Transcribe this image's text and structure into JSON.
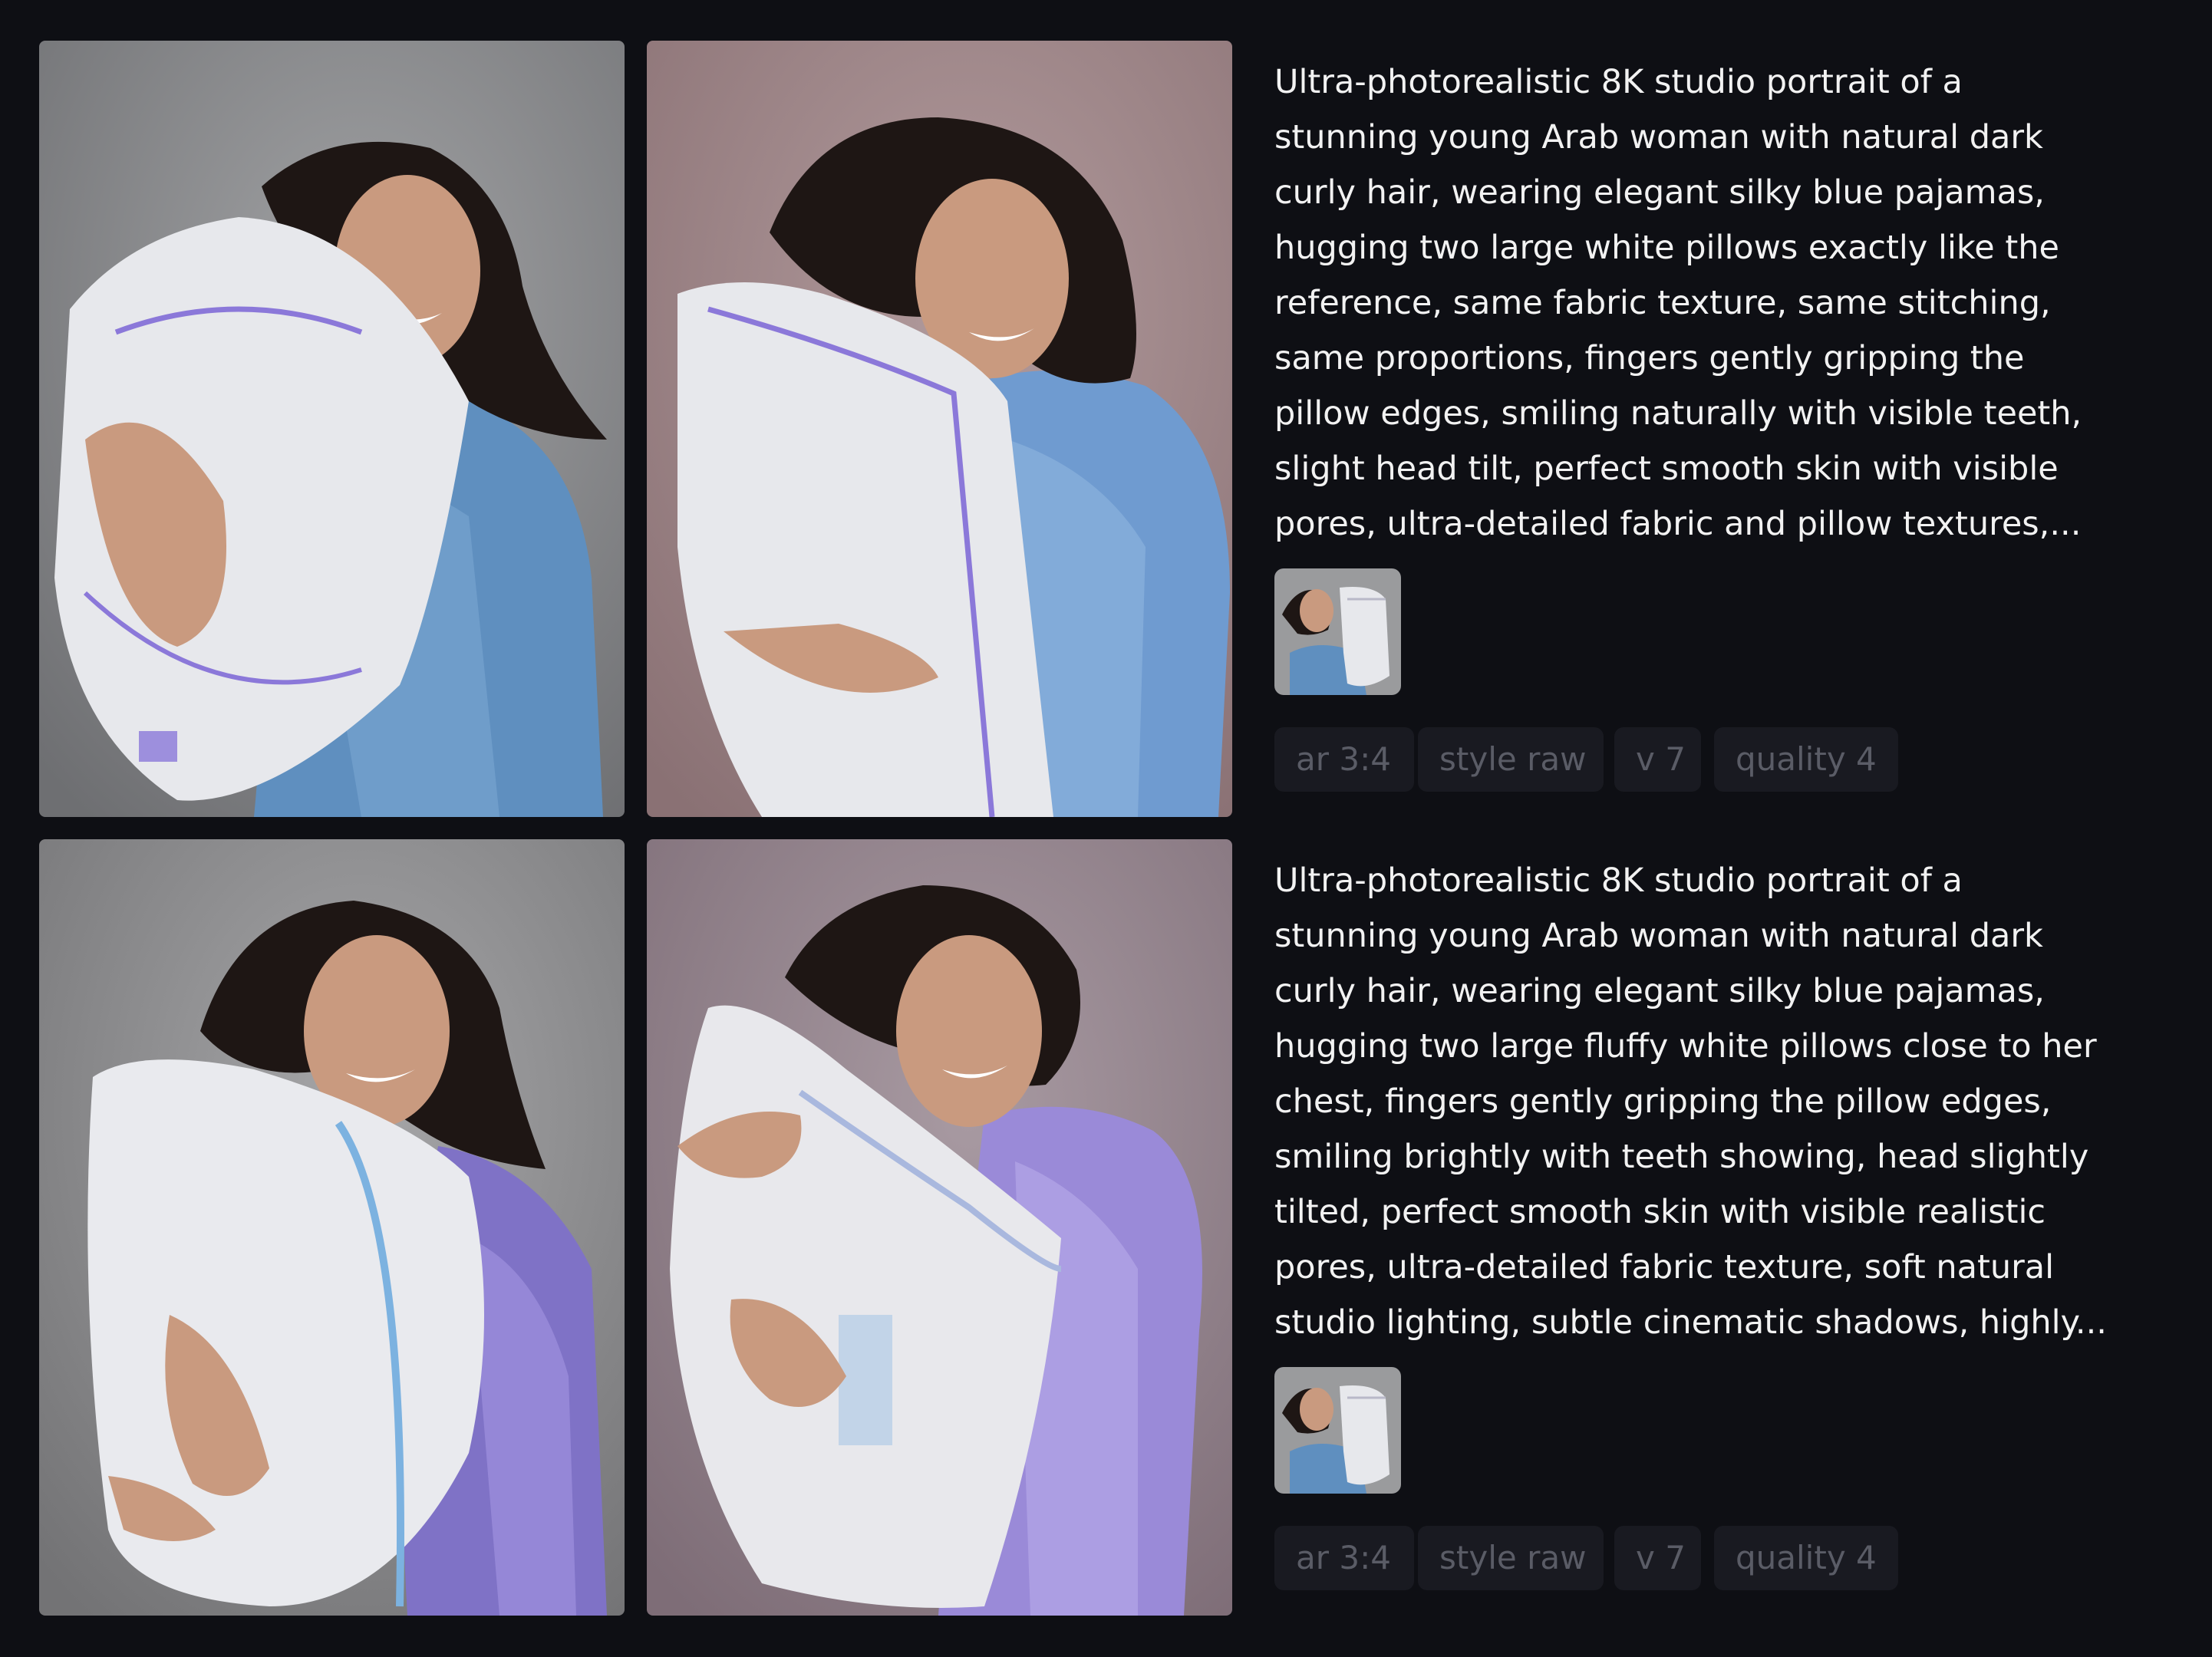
{
  "jobs": [
    {
      "images": [
        {
          "subject": "woman-hugging-pillow",
          "pajama_color": "#5f8fbf",
          "background_color": "#8a8b8d"
        },
        {
          "subject": "woman-hugging-pillow",
          "pajama_color": "#6f9bd0",
          "background_color": "#9c8486"
        }
      ],
      "prompt": "Ultra-photorealistic 8K studio portrait of a\nstunning young Arab woman with natural dark\ncurly hair, wearing elegant silky blue pajamas,\nhugging two large white pillows exactly like the\nreference, same fabric texture, same stitching,\nsame proportions, fingers gently gripping the\npillow edges, smiling naturally with visible teeth,\nslight head tilt, perfect smooth skin with visible\npores, ultra-detailed fabric and pillow textures,...",
      "reference_image": "reference-thumbnail",
      "params": [
        "ar 3:4",
        "style raw",
        "v 7",
        "quality 4"
      ]
    },
    {
      "images": [
        {
          "subject": "woman-hugging-pillow",
          "pajama_color": "#7f72c6",
          "background_color": "#8d8c8e"
        },
        {
          "subject": "woman-hugging-pillow",
          "pajama_color": "#9a8ad8",
          "background_color": "#8f7e88"
        }
      ],
      "prompt": "Ultra-photorealistic 8K studio portrait of a\nstunning young Arab woman with natural dark\ncurly hair, wearing elegant silky blue pajamas,\nhugging two large fluffy white pillows close to her\nchest, fingers gently gripping the pillow edges,\nsmiling brightly with teeth showing, head slightly\ntilted, perfect smooth skin with visible realistic\npores, ultra-detailed fabric texture, soft natural\nstudio lighting, subtle cinematic shadows, highly...",
      "reference_image": "reference-thumbnail",
      "params": [
        "ar 3:4",
        "style raw",
        "v 7",
        "quality 4"
      ]
    }
  ],
  "colors": {
    "page_background": "#0e0f14",
    "chip_background": "#191a21",
    "chip_text": "#5a5c66",
    "prompt_text": "#f2f2f2"
  }
}
